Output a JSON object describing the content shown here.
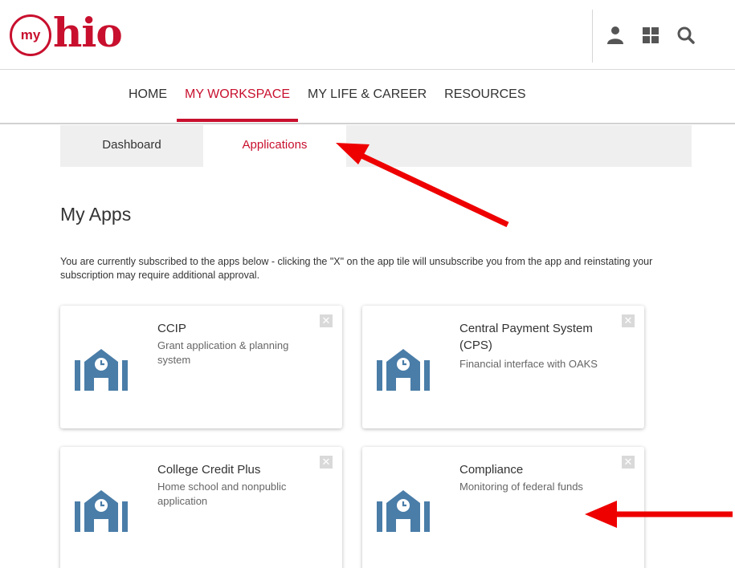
{
  "brand": {
    "logo_circle": "my",
    "logo_text": "hio",
    "color": "#c8102e"
  },
  "header": {
    "icons": [
      "user-icon",
      "apps-grid-icon",
      "search-icon"
    ]
  },
  "nav": {
    "items": [
      {
        "label": "HOME"
      },
      {
        "label": "MY WORKSPACE",
        "active": true
      },
      {
        "label": "MY LIFE & CAREER"
      },
      {
        "label": "RESOURCES"
      }
    ]
  },
  "subtabs": [
    {
      "label": "Dashboard"
    },
    {
      "label": "Applications",
      "active": true
    }
  ],
  "section": {
    "title": "My Apps",
    "intro": "You are currently subscribed to the apps below - clicking the \"X\" on the app tile will unsubscribe you from the app and reinstating your subscription may require additional approval."
  },
  "apps": [
    {
      "name": "CCIP",
      "description": "Grant application & planning system",
      "icon": "school-building-icon",
      "close": "✕"
    },
    {
      "name": "Central Payment System (CPS)",
      "description": "Financial interface with OAKS",
      "icon": "school-building-icon",
      "close": "✕"
    },
    {
      "name": "College Credit Plus",
      "description": "Home school and nonpublic application",
      "icon": "school-building-icon",
      "close": "✕"
    },
    {
      "name": "Compliance",
      "description": "Monitoring of federal funds",
      "icon": "school-building-icon",
      "close": "✕"
    }
  ],
  "colors": {
    "accent": "#c8102e",
    "icon_blue": "#4a7da8",
    "annotation_red": "#ee0000"
  }
}
